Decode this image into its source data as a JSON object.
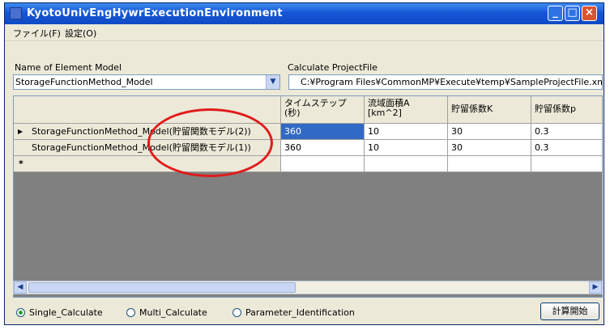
{
  "window": {
    "title": "KyotoUnivEngHywrExecutionEnvironment"
  },
  "menu": [
    {
      "label": "ファイル(F)"
    },
    {
      "label": "設定(O)"
    }
  ],
  "element_model": {
    "label": "Name of Element Model",
    "value": "StorageFunctionMethod_Model"
  },
  "project_file": {
    "label": "Calculate ProjectFile",
    "value": "C:¥Program Files¥CommonMP¥Execute¥temp¥SampleProjectFile.xml"
  },
  "grid": {
    "columns": [
      {
        "label": ""
      },
      {
        "label": "タイムステップ(秒)"
      },
      {
        "label": "流域面積A [km^2]"
      },
      {
        "label": "貯留係数K"
      },
      {
        "label": "貯留係数p"
      }
    ],
    "rows": [
      {
        "indicator": "▶",
        "name": "StorageFunctionMethod_Model(貯留関数モデル(2))",
        "timestep": "360",
        "area": "10",
        "k": "30",
        "p": "0.3"
      },
      {
        "indicator": "",
        "name": "StorageFunctionMethod_Model(貯留関数モデル(1))",
        "timestep": "360",
        "area": "10",
        "k": "30",
        "p": "0.3"
      }
    ],
    "new_row_indicator": "*"
  },
  "calc_mode": {
    "options": [
      {
        "label": "Single_Calculate",
        "selected": true
      },
      {
        "label": "Multi_Calculate",
        "selected": false
      },
      {
        "label": "Parameter_Identification",
        "selected": false
      }
    ]
  },
  "run_button": {
    "label": "計算開始"
  },
  "colors": {
    "title_bar": "#1657d6",
    "selection": "#316ac5",
    "annotation": "#e01b1b"
  }
}
